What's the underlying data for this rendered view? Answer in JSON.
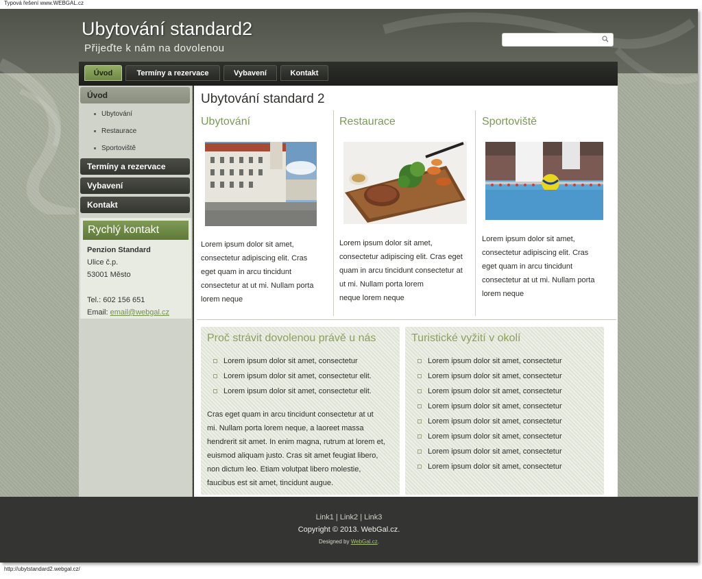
{
  "top_caption": "Typová řešení www.WEBGAL.cz",
  "status_url": "http://ubytstandard2.webgal.cz/",
  "header": {
    "title": "Ubytování standard2",
    "subtitle": "Přijeďte k nám na dovolenou",
    "search_placeholder": ""
  },
  "nav": [
    "Úvod",
    "Termíny a rezervace",
    "Vybavení",
    "Kontakt"
  ],
  "sidebar": {
    "items": [
      {
        "label": "Úvod"
      },
      {
        "label": "Termíny a rezervace"
      },
      {
        "label": "Vybavení"
      },
      {
        "label": "Kontakt"
      }
    ],
    "subitems": [
      "Ubytování",
      "Restaurace",
      "Sportoviště"
    ],
    "quick_contact": {
      "title": "Rychlý kontakt",
      "name": "Penzion Standard",
      "street": "Ulice č.p.",
      "city": "53001 Město",
      "phone": "Tel.: 602 156 651",
      "email_label": "Email:",
      "email": "email@webgal.cz"
    }
  },
  "main": {
    "page_title": "Ubytování standard 2",
    "columns": [
      {
        "title": "Ubytování",
        "lines": [
          "Lorem ipsum dolor sit amet,",
          "consectetur adipiscing elit. Cras",
          "eget quam in arcu tincidunt",
          "consectetur at ut mi. Nullam porta",
          "lorem neque"
        ]
      },
      {
        "title": "Restaurace",
        "lines": [
          "Lorem ipsum dolor sit amet,",
          "consectetur adipiscing elit. Cras eget",
          "quam in arcu tincidunt consectetur at",
          "ut mi. Nullam porta lorem",
          "neque lorem neque"
        ]
      },
      {
        "title": "Sportoviště",
        "lines": [
          "Lorem ipsum dolor sit amet,",
          "consectetur adipiscing elit. Cras",
          "eget quam in arcu tincidunt",
          "consectetur at ut mi. Nullam porta",
          "lorem neque"
        ]
      }
    ],
    "why": {
      "title": "Proč strávit dovolenou právě u nás",
      "bullets": [
        "Lorem ipsum dolor sit amet, consectetur",
        "Lorem ipsum dolor sit amet, consectetur elit.",
        "Lorem ipsum dolor sit amet, consectetur  elit."
      ],
      "lines": [
        "Cras eget quam in arcu tincidunt consectetur at ut",
        "mi. Nullam porta lorem neque, a laoreet massa",
        "hendrerit sit amet. In enim magna, rutrum at lorem et,",
        "euismod aliquam justo. Cras sit amet feugiat libero,",
        "non dictum leo. Etiam volutpat libero molestie,",
        "faucibus est sit amet, tincidunt augue."
      ]
    },
    "tourism": {
      "title": "Turistické vyžití v okolí",
      "bullets": [
        "Lorem ipsum dolor sit amet, consectetur",
        "Lorem ipsum dolor sit amet, consectetur",
        "Lorem ipsum dolor sit amet, consectetur",
        "Lorem ipsum dolor sit amet, consectetur",
        "Lorem ipsum dolor sit amet, consectetur",
        "Lorem ipsum dolor sit amet, consectetur",
        "Lorem ipsum dolor sit amet, consectetur",
        "Lorem ipsum dolor sit amet, consectetur"
      ]
    }
  },
  "footer": {
    "links": [
      "Link1",
      "Link2",
      "Link3"
    ],
    "copyright": "Copyright © 2013. WebGal.cz.",
    "designed_by": "Designed by",
    "designed_link": "WebGal.cz",
    "designed_end": "."
  },
  "colors": {
    "accent_green": "#7c9a52",
    "footer_bg": "#343532",
    "nav_active": "#8aa35c"
  }
}
